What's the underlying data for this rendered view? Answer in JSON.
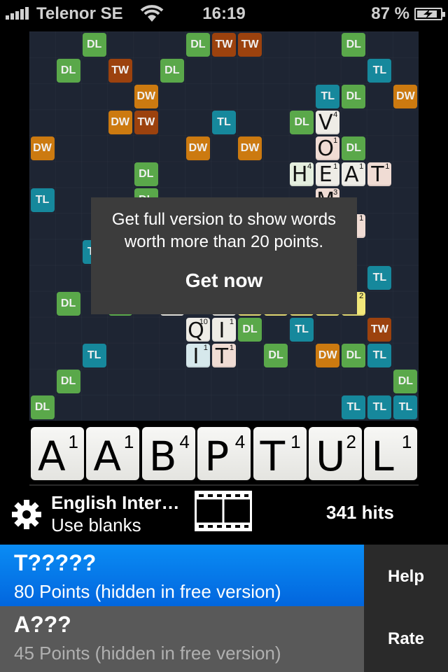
{
  "status_bar": {
    "carrier": "Telenor SE",
    "time": "16:19",
    "battery_percent": "87 %",
    "battery_level": 0.87,
    "signal_bars": 5,
    "icons": [
      "signal-icon",
      "wifi-icon",
      "battery-charging-icon"
    ]
  },
  "colors": {
    "DL": "#5aa84a",
    "TL": "#16889c",
    "DW": "#cc7a10",
    "TW": "#9c420e",
    "board": "#1e2533",
    "selected_result": "#0a7ef0"
  },
  "board": {
    "size": 15,
    "premium_cells": [
      {
        "r": 0,
        "c": 2,
        "type": "DL"
      },
      {
        "r": 0,
        "c": 6,
        "type": "DL"
      },
      {
        "r": 0,
        "c": 7,
        "type": "TW"
      },
      {
        "r": 0,
        "c": 8,
        "type": "TW"
      },
      {
        "r": 0,
        "c": 12,
        "type": "DL"
      },
      {
        "r": 1,
        "c": 1,
        "type": "DL"
      },
      {
        "r": 1,
        "c": 3,
        "type": "TW"
      },
      {
        "r": 1,
        "c": 5,
        "type": "DL"
      },
      {
        "r": 1,
        "c": 13,
        "type": "TL"
      },
      {
        "r": 2,
        "c": 4,
        "type": "DW"
      },
      {
        "r": 2,
        "c": 11,
        "type": "TL"
      },
      {
        "r": 2,
        "c": 12,
        "type": "DL"
      },
      {
        "r": 2,
        "c": 14,
        "type": "DW"
      },
      {
        "r": 3,
        "c": 3,
        "type": "DW"
      },
      {
        "r": 3,
        "c": 4,
        "type": "TW"
      },
      {
        "r": 3,
        "c": 7,
        "type": "TL"
      },
      {
        "r": 3,
        "c": 10,
        "type": "DL"
      },
      {
        "r": 4,
        "c": 0,
        "type": "DW"
      },
      {
        "r": 4,
        "c": 6,
        "type": "DW"
      },
      {
        "r": 4,
        "c": 8,
        "type": "DW"
      },
      {
        "r": 4,
        "c": 12,
        "type": "DL"
      },
      {
        "r": 5,
        "c": 4,
        "type": "DL"
      },
      {
        "r": 6,
        "c": 0,
        "type": "TL"
      },
      {
        "r": 6,
        "c": 4,
        "type": "DL"
      },
      {
        "r": 8,
        "c": 2,
        "type": "TL"
      },
      {
        "r": 9,
        "c": 13,
        "type": "TL"
      },
      {
        "r": 10,
        "c": 1,
        "type": "DL"
      },
      {
        "r": 10,
        "c": 3,
        "type": "DL"
      },
      {
        "r": 11,
        "c": 8,
        "type": "DL"
      },
      {
        "r": 11,
        "c": 10,
        "type": "TL"
      },
      {
        "r": 11,
        "c": 13,
        "type": "TW"
      },
      {
        "r": 12,
        "c": 2,
        "type": "TL"
      },
      {
        "r": 12,
        "c": 9,
        "type": "DL"
      },
      {
        "r": 12,
        "c": 11,
        "type": "DW"
      },
      {
        "r": 12,
        "c": 12,
        "type": "DL"
      },
      {
        "r": 12,
        "c": 13,
        "type": "TL"
      },
      {
        "r": 13,
        "c": 1,
        "type": "DL"
      },
      {
        "r": 13,
        "c": 14,
        "type": "DL"
      },
      {
        "r": 14,
        "c": 0,
        "type": "DL"
      },
      {
        "r": 14,
        "c": 12,
        "type": "TL"
      },
      {
        "r": 14,
        "c": 13,
        "type": "TL"
      },
      {
        "r": 14,
        "c": 14,
        "type": "TL"
      }
    ],
    "tiles": [
      {
        "r": 3,
        "c": 11,
        "letter": "V",
        "score": "4",
        "tint": ""
      },
      {
        "r": 4,
        "c": 11,
        "letter": "O",
        "score": "1",
        "tint": "pink"
      },
      {
        "r": 5,
        "c": 10,
        "letter": "H",
        "score": "4",
        "tint": "green"
      },
      {
        "r": 5,
        "c": 11,
        "letter": "E",
        "score": "1",
        "tint": ""
      },
      {
        "r": 5,
        "c": 12,
        "letter": "A",
        "score": "1",
        "tint": ""
      },
      {
        "r": 5,
        "c": 13,
        "letter": "T",
        "score": "1",
        "tint": "pink"
      },
      {
        "r": 6,
        "c": 11,
        "letter": "M",
        "score": "3",
        "tint": "pink"
      },
      {
        "r": 7,
        "c": 12,
        "letter": "",
        "score": "1",
        "tint": "pink"
      },
      {
        "r": 10,
        "c": 5,
        "letter": "",
        "score": "",
        "tint": ""
      },
      {
        "r": 10,
        "c": 7,
        "letter": "",
        "score": "",
        "tint": ""
      },
      {
        "r": 10,
        "c": 8,
        "letter": "",
        "score": "",
        "tint": "yellow"
      },
      {
        "r": 10,
        "c": 9,
        "letter": "",
        "score": "",
        "tint": "yellow"
      },
      {
        "r": 10,
        "c": 10,
        "letter": "",
        "score": "",
        "tint": "yellow"
      },
      {
        "r": 10,
        "c": 11,
        "letter": "",
        "score": "",
        "tint": "yellow"
      },
      {
        "r": 10,
        "c": 12,
        "letter": "",
        "score": "2",
        "tint": "yellow"
      },
      {
        "r": 11,
        "c": 6,
        "letter": "Q",
        "score": "10",
        "tint": ""
      },
      {
        "r": 11,
        "c": 7,
        "letter": "I",
        "score": "1",
        "tint": ""
      },
      {
        "r": 12,
        "c": 6,
        "letter": "I",
        "score": "1",
        "tint": "blue"
      },
      {
        "r": 12,
        "c": 7,
        "letter": "T",
        "score": "1",
        "tint": "pink"
      }
    ]
  },
  "popup": {
    "message": "Get full version to show words worth more than 20 points.",
    "button": "Get now"
  },
  "rack": [
    {
      "letter": "A",
      "score": "1"
    },
    {
      "letter": "A",
      "score": "1"
    },
    {
      "letter": "B",
      "score": "4"
    },
    {
      "letter": "P",
      "score": "4"
    },
    {
      "letter": "T",
      "score": "1"
    },
    {
      "letter": "U",
      "score": "2"
    },
    {
      "letter": "L",
      "score": "1"
    }
  ],
  "settings": {
    "dictionary": "English Inter…",
    "blanks": "Use blanks",
    "hits": "341 hits"
  },
  "results": [
    {
      "word": "T?????",
      "points": "80 Points (hidden in free version)",
      "selected": true
    },
    {
      "word": "A???",
      "points": "45 Points (hidden in free version)",
      "selected": false
    }
  ],
  "side_buttons": {
    "help": "Help",
    "rate": "Rate"
  }
}
